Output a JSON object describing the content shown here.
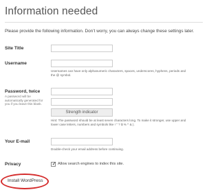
{
  "header": {
    "title": "Information needed"
  },
  "intro_text": "Please provide the following information. Don’t worry, you can always change these settings later.",
  "form": {
    "site_title": {
      "label": "Site Title",
      "value": ""
    },
    "username": {
      "label": "Username",
      "value": "",
      "hint_line1": "Usernames can have only alphanumeric characters, spaces, underscores, hyphens, periods and",
      "hint_line2": "the @ symbol."
    },
    "password": {
      "label": "Password, twice",
      "note": "A password will be automatically generated for you if you leave this blank.",
      "value1": "",
      "value2": "",
      "strength_label": "Strength indicator",
      "hint_line1": "Hint: The password should be at least seven characters long. To make it stronger, use upper and",
      "hint_line2": "lower case letters, numbers and symbols like ! \" ? $ % ^ & )."
    },
    "email": {
      "label": "Your E-mail",
      "value": "",
      "hint": "Double-check your email address before continuing."
    },
    "privacy": {
      "label": "Privacy",
      "checkbox_label": "Allow search engines to index this site.",
      "checked": true
    }
  },
  "install_button": {
    "label": "Install WordPress",
    "highlight_color": "#d42b2b"
  }
}
